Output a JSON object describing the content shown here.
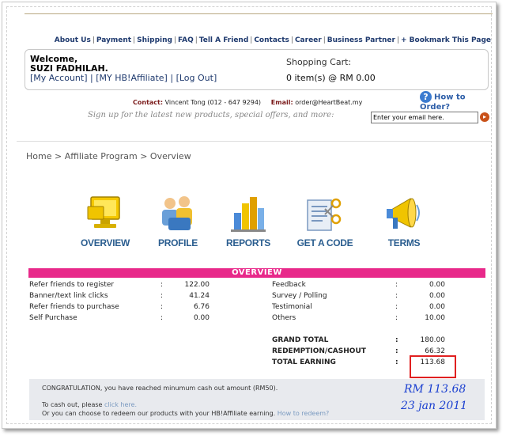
{
  "nav": [
    "About Us",
    "Payment",
    "Shipping",
    "FAQ",
    "Tell A Friend",
    "Contacts",
    "Career",
    "Business Partner",
    "+ Bookmark This Page"
  ],
  "welcome": {
    "greeting": "Welcome,",
    "name": "SUZI FADHILAH.",
    "my_account": "[My Account]",
    "affiliate": "[MY HB!Affiliate]",
    "logout": "[Log Out]",
    "sep": "|"
  },
  "cart": {
    "label": "Shopping Cart:",
    "value": "0 item(s) @ RM 0.00"
  },
  "howto": {
    "icon": "?",
    "label": "How to Order?"
  },
  "contact": {
    "contact_label": "Contact:",
    "contact_value": "Vincent Tong (012 - 647 9294)",
    "email_label": "Email:",
    "email_value": "order@HeartBeat.my"
  },
  "signup": {
    "text": "Sign up for the latest new products, special offers, and more:",
    "input_value": "Enter your email here.",
    "go": "▸"
  },
  "breadcrumb": "Home > Affiliate Program > Overview",
  "icons": [
    {
      "label": "OVERVIEW",
      "icon": "monitor-icon"
    },
    {
      "label": "PROFILE",
      "icon": "people-icon"
    },
    {
      "label": "REPORTS",
      "icon": "bar-chart-icon"
    },
    {
      "label": "GET A CODE",
      "icon": "scissors-document-icon"
    },
    {
      "label": "TERMS",
      "icon": "megaphone-icon"
    }
  ],
  "overview": {
    "title": "OVERVIEW",
    "colon": ":",
    "left": [
      {
        "label": "Refer friends to register",
        "value": "122.00"
      },
      {
        "label": "Banner/text link clicks",
        "value": "41.24"
      },
      {
        "label": "Refer friends to purchase",
        "value": "6.76"
      },
      {
        "label": "Self Purchase",
        "value": "0.00"
      }
    ],
    "right": [
      {
        "label": "Feedback",
        "value": "0.00"
      },
      {
        "label": "Survey / Polling",
        "value": "0.00"
      },
      {
        "label": "Testimonial",
        "value": "0.00"
      },
      {
        "label": "Others",
        "value": "10.00"
      }
    ],
    "totals": [
      {
        "label": "GRAND TOTAL",
        "value": "180.00"
      },
      {
        "label": "REDEMPTION/CASHOUT",
        "value": "66.32"
      },
      {
        "label": "TOTAL EARNING",
        "value": "113.68"
      }
    ]
  },
  "congrats": {
    "line1": "CONGRATULATION, you have reached minumum cash out amount (RM50).",
    "line2_prefix": "To cash out, please ",
    "line2_link": "click here.",
    "line3_prefix": "Or you can choose to redeem our products with your HB!Affiliate earning. ",
    "line3_link": "How to redeem?"
  },
  "handwritten": {
    "amount": "RM 113.68",
    "date": "23 jan 2011"
  },
  "colors": {
    "pink": "#e8298a",
    "navy": "#1f3a6e",
    "red": "#e02020",
    "blue_ink": "#1a3fd0"
  }
}
